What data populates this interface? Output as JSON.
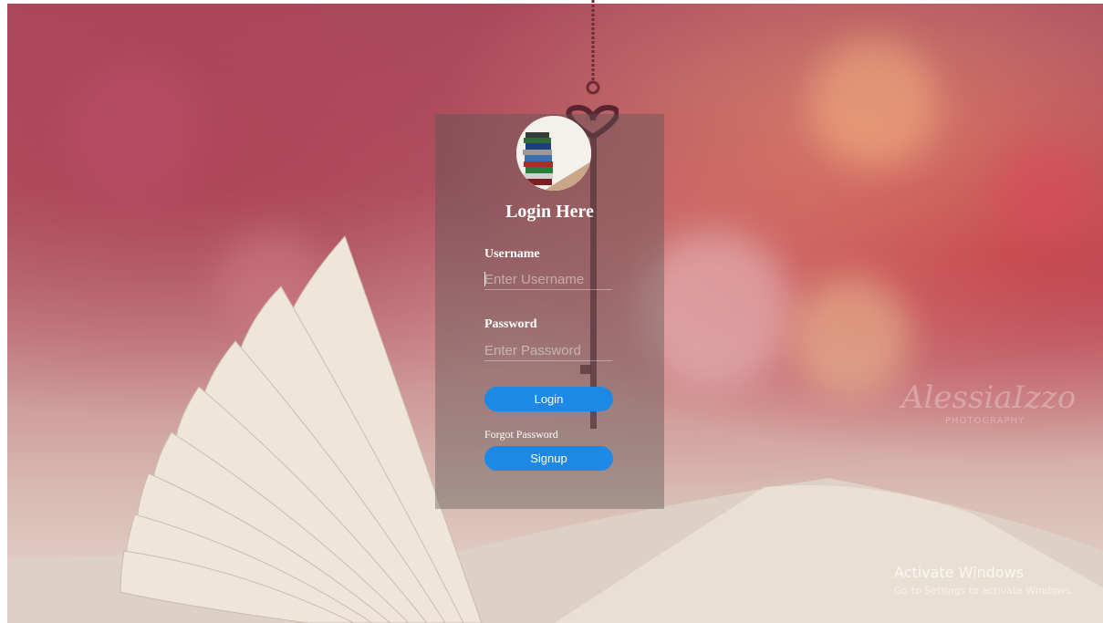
{
  "login": {
    "title": "Login Here",
    "username_label": "Username",
    "username_placeholder": "Enter Username",
    "password_label": "Password",
    "password_placeholder": "Enter Password",
    "login_button": "Login",
    "forgot_link": "Forgot Password",
    "signup_button": "Signup"
  },
  "background": {
    "watermark": "AlessiaIzzo",
    "watermark_sub": "PHOTOGRAPHY"
  },
  "windows_notice": {
    "title": "Activate Windows",
    "subtitle": "Go to Settings to activate Windows."
  },
  "colors": {
    "button": "#1e88e5",
    "panel": "rgba(90,85,85,0.42)",
    "background_top": "#a94a5e"
  },
  "icons": {
    "avatar": "books-stack-icon",
    "key": "key-pendant-icon"
  }
}
